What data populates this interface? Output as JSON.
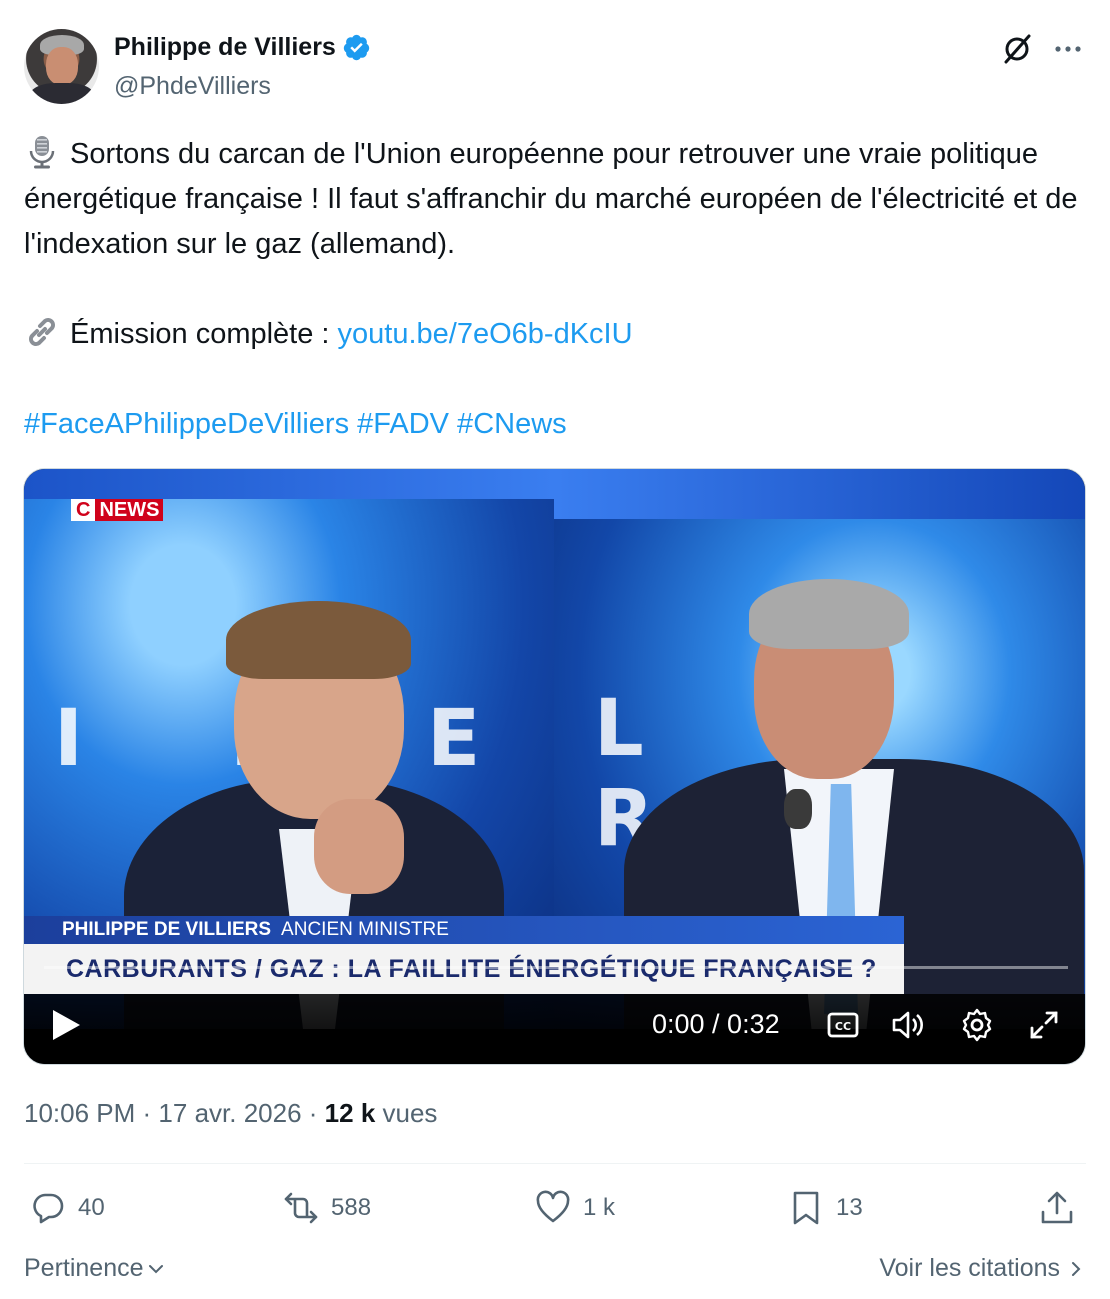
{
  "author": {
    "name": "Philippe de Villiers",
    "handle": "@PhdeVilliers"
  },
  "tweet": {
    "line1": "Sortons du carcan de l'Union européenne pour retrouver une vraie politique énergétique française ! Il faut s'affranchir du marché européen de l'électricité et de l'indexation sur le gaz (allemand).",
    "link_prefix": "Émission complète : ",
    "link": "youtu.be/7eO6b-dKcIU",
    "hashtags": "#FaceAPhilippeDeVilliers #FADV #CNews"
  },
  "video": {
    "channel_logo_c": "C",
    "channel_logo_news": "NEWS",
    "lower_third_name": "PHILIPPE DE VILLIERS",
    "lower_third_role": "ANCIEN MINISTRE",
    "headline": "CARBURANTS / GAZ : LA FAILLITE ÉNERGÉTIQUE FRANÇAISE ?",
    "time": "0:00 / 0:32",
    "progress": 0
  },
  "meta": {
    "time": "10:06 PM",
    "date": "17 avr. 2026",
    "views_count": "12 k",
    "views_label": "vues"
  },
  "actions": {
    "replies": "40",
    "reposts": "588",
    "likes": "1 k",
    "bookmarks": "13"
  },
  "footer": {
    "sort_label": "Pertinence",
    "quotes_label": "Voir les citations"
  },
  "colors": {
    "accent": "#1d9bf0",
    "text": "#0f1419",
    "muted": "#536471"
  }
}
